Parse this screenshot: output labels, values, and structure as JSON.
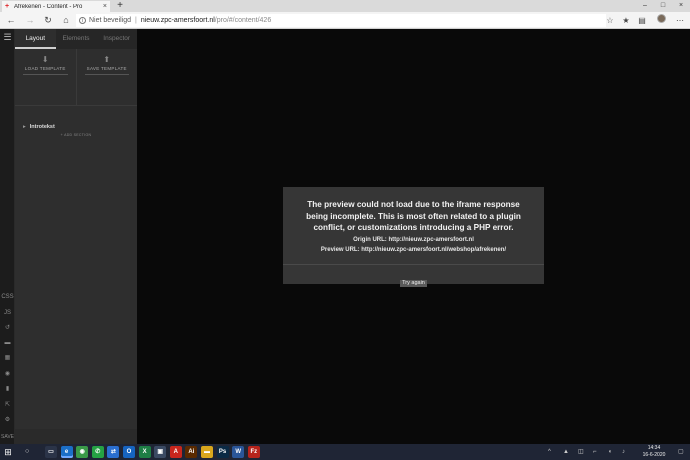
{
  "browser": {
    "tab_title": "Afrekenen - Content - Pro",
    "tab_close": "×",
    "new_tab": "+",
    "favicon": "+",
    "window_controls": [
      "–",
      "□",
      "×"
    ],
    "back": "←",
    "forward": "→",
    "reload": "↻",
    "home": "⌂",
    "info": "i",
    "security_label": "Niet beveiligd",
    "separator": "|",
    "url_host": "nieuw.zpc-amersfoort.nl",
    "url_path": "/pro/#/content/426",
    "toolbar_icons": [
      "star-icon",
      "favorites-icon",
      "collections-icon",
      "share-icon",
      "more-icon"
    ],
    "toolbar_glyphs": [
      "☆",
      "★",
      "▤",
      "⇪",
      "⋯"
    ]
  },
  "rail": {
    "menu": "☰",
    "items": [
      "CSS",
      "JS",
      "↺",
      "▬",
      "▦",
      "◉",
      "▮",
      "⇱",
      "⚙",
      "SAVE"
    ]
  },
  "panel": {
    "tabs": [
      "Layout",
      "Elements",
      "Inspector"
    ],
    "active_tab": "Layout",
    "load_template": "LOAD TEMPLATE",
    "save_template": "SAVE TEMPLATE",
    "template_icon": "⬇",
    "template_icon_up": "⬆",
    "section_caret": "▸",
    "section_name": "Introtekst",
    "add_section": "+ ADD SECTION"
  },
  "modal": {
    "title_lines": [
      "The preview could not load due to the iframe response",
      "being incomplete. This is most often related to a plugin",
      "conflict, or customizations introducing a PHP error."
    ],
    "origin": "Origin URL: http://nieuw.zpc-amersfoort.nl",
    "preview": "Preview URL: http://nieuw.zpc-amersfoort.nl/webshop/afrekenen/",
    "button": "Try again"
  },
  "taskbar": {
    "start": "⊞",
    "search": "○",
    "apps": [
      {
        "name": "task-view",
        "glyph": "▭",
        "color": "#2b3448"
      },
      {
        "name": "edge",
        "glyph": "e",
        "color": "#1b6fc7",
        "active": true
      },
      {
        "name": "chrome",
        "glyph": "◉",
        "color": "#3a9a48"
      },
      {
        "name": "whatsapp",
        "glyph": "✆",
        "color": "#25a244"
      },
      {
        "name": "teamviewer",
        "glyph": "⇄",
        "color": "#2a6fd0"
      },
      {
        "name": "outlook",
        "glyph": "O",
        "color": "#1664c0"
      },
      {
        "name": "excel",
        "glyph": "X",
        "color": "#1e7e45"
      },
      {
        "name": "photo",
        "glyph": "▣",
        "color": "#3b4a63"
      },
      {
        "name": "acrobat",
        "glyph": "A",
        "color": "#c8261d"
      },
      {
        "name": "illustrator",
        "glyph": "Ai",
        "color": "#5a2a00"
      },
      {
        "name": "explorer",
        "glyph": "▬",
        "color": "#d9a71d"
      },
      {
        "name": "photoshop",
        "glyph": "Ps",
        "color": "#0b2a45"
      },
      {
        "name": "word",
        "glyph": "W",
        "color": "#2a5699"
      },
      {
        "name": "filezilla",
        "glyph": "Fz",
        "color": "#b7241c"
      }
    ],
    "tray_glyphs": [
      "^",
      "▲",
      "◫",
      "⌐",
      "◖",
      "♪"
    ],
    "time": "14:34",
    "date": "16-6-2020",
    "notif": "▢"
  }
}
